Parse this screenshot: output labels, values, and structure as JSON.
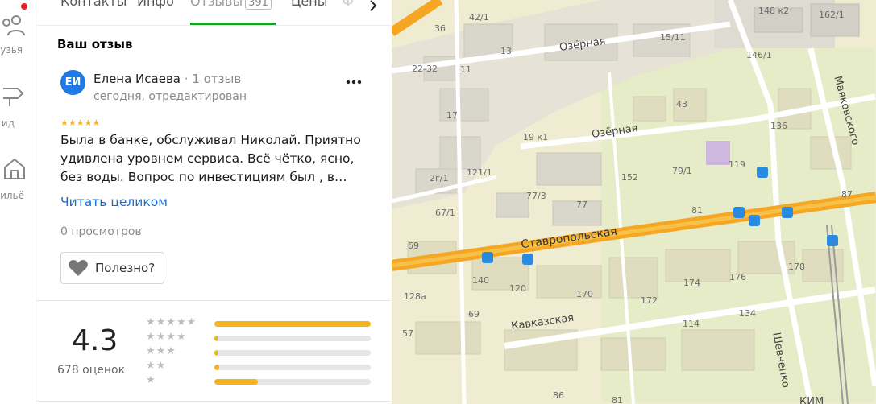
{
  "rail": {
    "items": [
      {
        "label": "узья",
        "icon": "friends-icon"
      },
      {
        "label": "ид",
        "icon": "guide-icon"
      },
      {
        "label": "ильё",
        "icon": "housing-icon"
      }
    ]
  },
  "tabs": {
    "items": [
      {
        "label": "Контакты"
      },
      {
        "label": "Инфо"
      },
      {
        "label": "Отзывы",
        "count": "391"
      },
      {
        "label": "Цены"
      },
      {
        "label": "Ф"
      }
    ]
  },
  "review": {
    "section_title": "Ваш отзыв",
    "avatar_initials": "ЕИ",
    "author": "Елена Исаева",
    "author_meta": "· 1 отзыв",
    "date": "сегодня, отредактирован",
    "rating": 5,
    "stars": "★★★★★",
    "text": "Была в банке, обслуживал Николай. Приятно удивлена уровнем сервиса. Всё чётко, ясно, без воды. Вопрос по инвестициям был , в…",
    "read_more": "Читать целиком",
    "views": "0 просмотров",
    "useful_label": "Полезно?"
  },
  "rating_summary": {
    "value": "4.3",
    "count_label": "678 оценок",
    "distribution": [
      {
        "stars": "★★★★★",
        "fraction": 1.0
      },
      {
        "stars": "★★★★",
        "fraction": 0.02
      },
      {
        "stars": "★★★",
        "fraction": 0.02
      },
      {
        "stars": "★★",
        "fraction": 0.03
      },
      {
        "stars": "★",
        "fraction": 0.28
      }
    ]
  },
  "map": {
    "streets": {
      "ozernaya_top": "Озёрная",
      "ozernaya_mid": "Озёрная",
      "stavropolskaya": "Ставропольская",
      "kavkazskaya": "Кавказская",
      "mayakovskogo": "Маяковского",
      "shevchenko": "Шевченко",
      "kim": "КИМ"
    },
    "house_numbers": [
      "42/1",
      "36",
      "13",
      "22-32",
      "11",
      "15/11",
      "146/1",
      "148 к2",
      "162/1",
      "17",
      "43",
      "19 к1",
      "136",
      "2г/1",
      "121/1",
      "152",
      "79/1",
      "119",
      "77/3",
      "77",
      "67/1",
      "81",
      "87",
      "69",
      "140",
      "120",
      "170",
      "174",
      "176",
      "178",
      "128а",
      "69",
      "172",
      "57",
      "114",
      "134",
      "86",
      "81"
    ]
  },
  "colors": {
    "accent_green": "#1b9e2a",
    "star_yellow": "#f6b21a",
    "link_blue": "#1a6cd4",
    "avatar_blue": "#1e7ae6",
    "notification_red": "#e8212b"
  }
}
